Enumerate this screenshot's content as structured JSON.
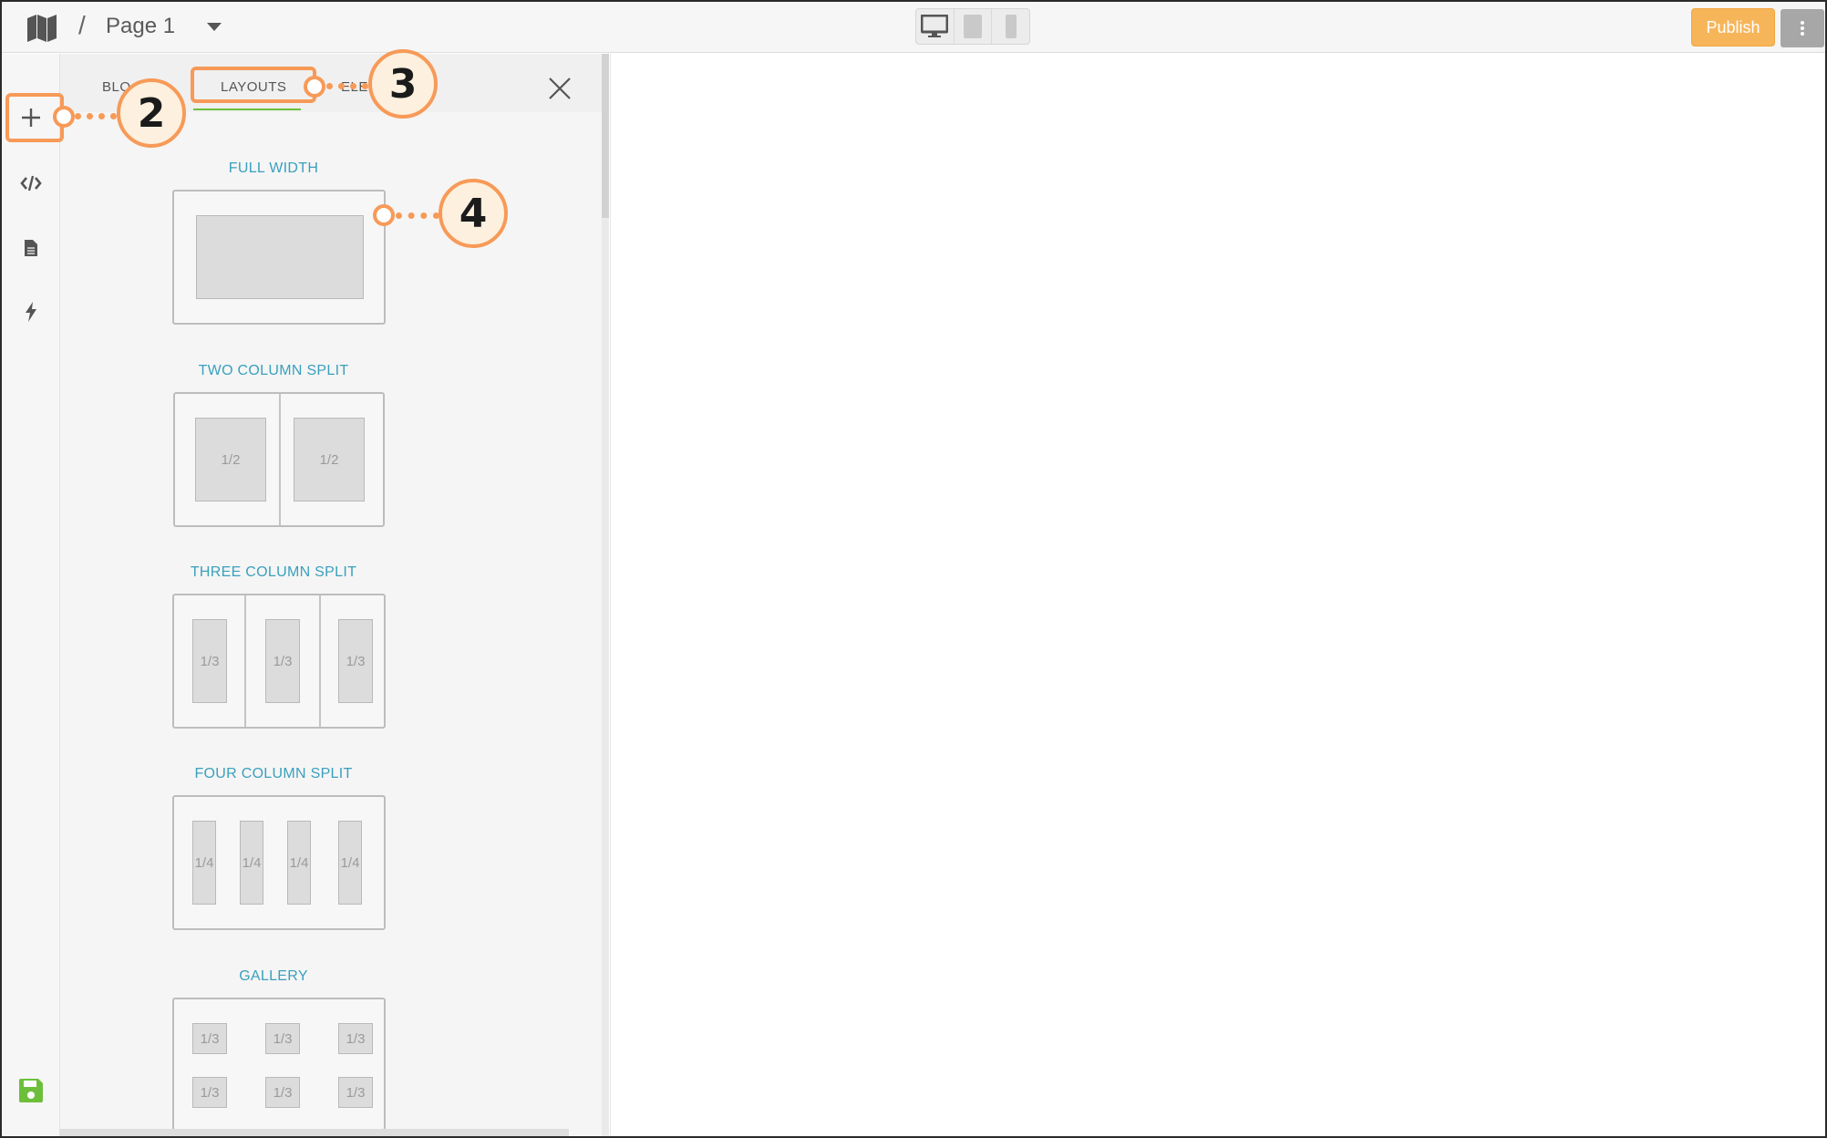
{
  "header": {
    "breadcrumb_sep": "/",
    "page_title": "Page 1",
    "publish_label": "Publish",
    "device_modes": [
      "desktop",
      "tablet",
      "mobile"
    ],
    "active_device": "desktop"
  },
  "rail": {
    "items": [
      {
        "icon": "plus-icon",
        "name": "add"
      },
      {
        "icon": "code-icon",
        "name": "code"
      },
      {
        "icon": "document-icon",
        "name": "pages"
      },
      {
        "icon": "lightning-icon",
        "name": "actions"
      },
      {
        "icon": "save-icon",
        "name": "save"
      }
    ]
  },
  "panel": {
    "tabs": [
      {
        "label": "BLO"
      },
      {
        "label": "LAYOUTS"
      },
      {
        "label": "ELE"
      }
    ],
    "active_tab": "LAYOUTS",
    "layouts": [
      {
        "title": "FULL WIDTH",
        "cells": []
      },
      {
        "title": "TWO COLUMN SPLIT",
        "cells": [
          "1/2",
          "1/2"
        ]
      },
      {
        "title": "THREE COLUMN SPLIT",
        "cells": [
          "1/3",
          "1/3",
          "1/3"
        ]
      },
      {
        "title": "FOUR COLUMN SPLIT",
        "cells": [
          "1/4",
          "1/4",
          "1/4",
          "1/4"
        ]
      },
      {
        "title": "GALLERY",
        "cells": [
          "1/3",
          "1/3",
          "1/3",
          "1/3",
          "1/3",
          "1/3"
        ]
      }
    ]
  },
  "callouts": [
    {
      "number": "2"
    },
    {
      "number": "3"
    },
    {
      "number": "4"
    }
  ],
  "colors": {
    "accent_callout": "#f79a58",
    "publish": "#f7b55a",
    "layout_title": "#3aa0bd",
    "tab_underline": "#6dbf3b",
    "save_icon": "#6dbf3b"
  }
}
